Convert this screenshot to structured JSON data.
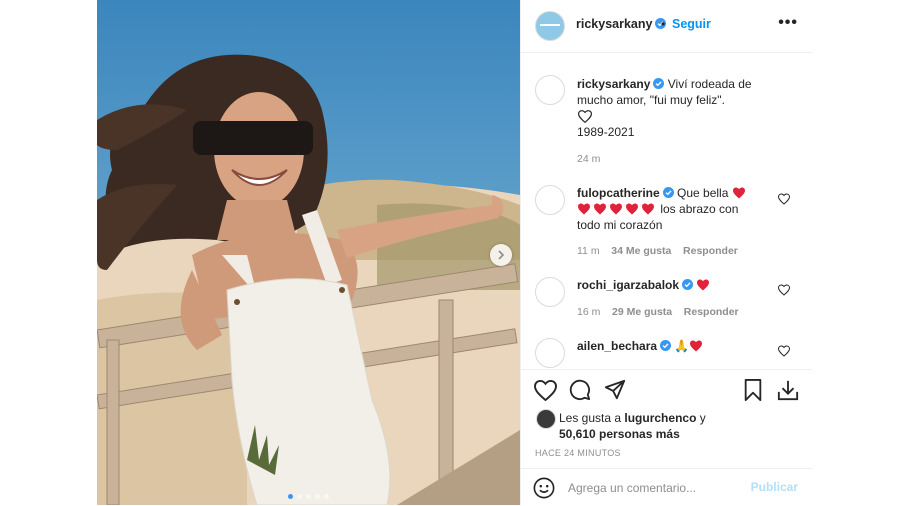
{
  "post": {
    "username": "rickysarkany",
    "follow_label": "Seguir",
    "separator": "•",
    "more_label": "•••"
  },
  "caption": {
    "username": "rickysarkany",
    "text_line1": "Viví rodeada de",
    "text_line2": "mucho amor, \"fui muy feliz\".",
    "years": "1989-2021",
    "time": "24 m"
  },
  "comments": [
    {
      "username": "fulopcatherine",
      "text_prefix": "Que bella",
      "text_suffix": "los abrazo con",
      "text_line3": "todo mi corazón",
      "time": "11 m",
      "likes": "34 Me gusta",
      "reply": "Responder"
    },
    {
      "username": "rochi_igarzabalok",
      "time": "16 m",
      "likes": "29 Me gusta",
      "reply": "Responder"
    },
    {
      "username": "ailen_bechara",
      "emoji": "🙏"
    }
  ],
  "likes": {
    "prefix": "Les gusta a",
    "user": "lugurchenco",
    "suffix": "y",
    "others": "50,610 personas más"
  },
  "time_ago": "HACE 24 MINUTOS",
  "add_comment": {
    "placeholder": "Agrega un comentario...",
    "publish": "Publicar"
  },
  "colors": {
    "accent": "#0095f6",
    "heart_red": "#ed4956",
    "verified": "#3897f0"
  }
}
